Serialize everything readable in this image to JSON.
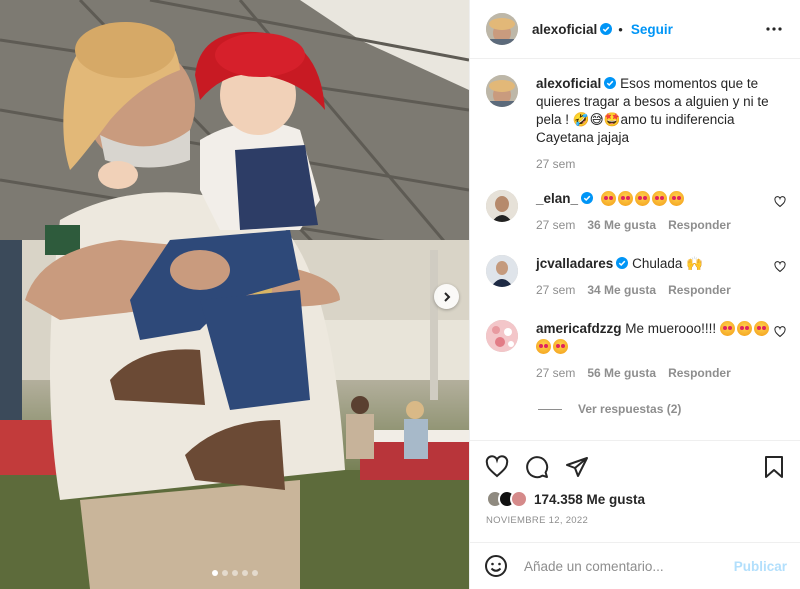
{
  "post": {
    "author": "alexoficial",
    "follow_label": "Seguir",
    "caption": "Esos momentos que te quieres tragar a besos a alguien y ni te pela ! 🤣😅🤩amo tu indiferencia Cayetana jajaja",
    "caption_time": "27 sem",
    "likes": "174.358 Me gusta",
    "date": "NOVIEMBRE 12, 2022"
  },
  "comments": [
    {
      "user": "_elan_",
      "verified": true,
      "text": "",
      "emojis": 5,
      "time": "27 sem",
      "likes": "36 Me gusta",
      "reply": "Responder"
    },
    {
      "user": "jcvalladares",
      "verified": true,
      "text": "Chulada 🙌",
      "emojis": 0,
      "time": "27 sem",
      "likes": "34 Me gusta",
      "reply": "Responder"
    },
    {
      "user": "americafdzzg",
      "verified": false,
      "text": "Me muerooo!!!!",
      "emojis": 5,
      "time": "27 sem",
      "likes": "56 Me gusta",
      "reply": "Responder"
    }
  ],
  "view_replies": "Ver respuestas (2)",
  "comment_box": {
    "placeholder": "Añade un comentario...",
    "publish_label": "Publicar"
  },
  "carousel": {
    "slides": 5,
    "active": 1
  },
  "colors": {
    "accent": "#0095f6",
    "verified": "#0095f6",
    "muted": "#8e8e8e"
  }
}
